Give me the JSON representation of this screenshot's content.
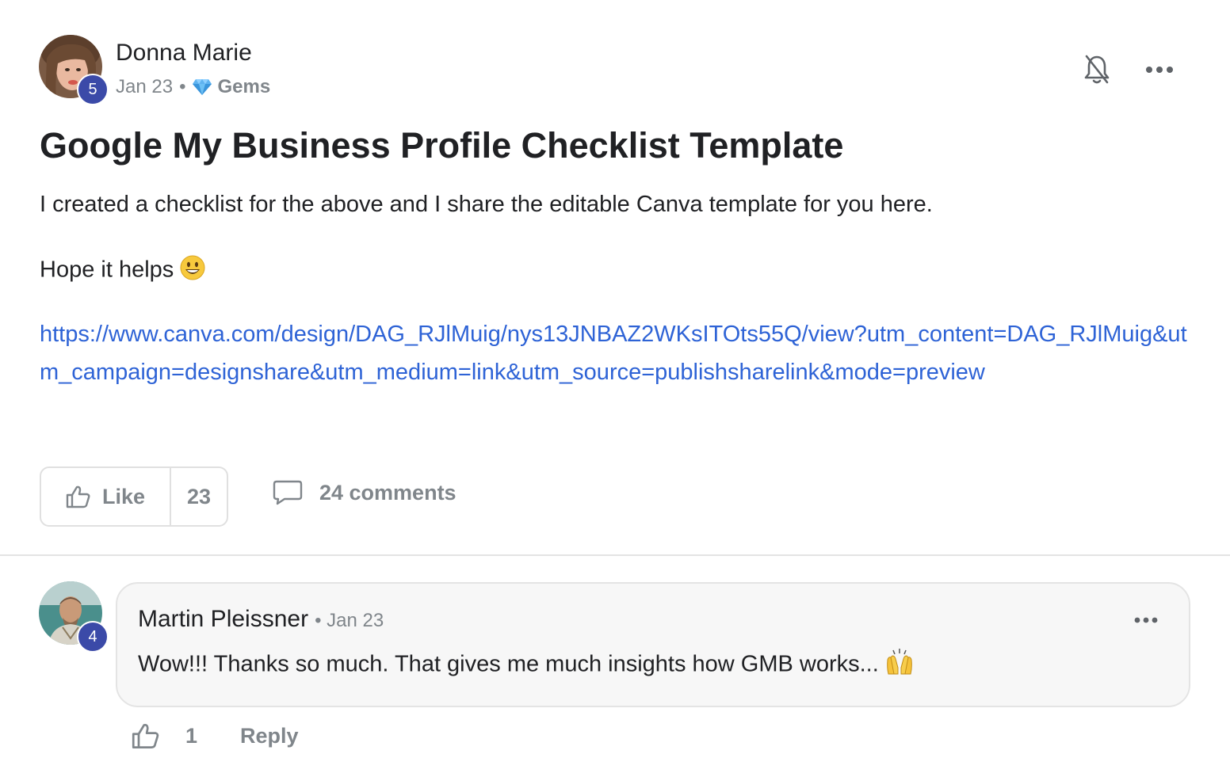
{
  "post": {
    "author": {
      "name": "Donna Marie",
      "level": "5"
    },
    "date": "Jan 23",
    "separator": "•",
    "category": "Gems",
    "title": "Google My Business Profile Checklist Template",
    "paragraphs": [
      "I created a checklist for the above and I share the editable Canva template for you here.",
      "Hope it helps"
    ],
    "link": "https://www.canva.com/design/DAG_RJlMuig/nys13JNBAZ2WKsITOts55Q/view?utm_content=DAG_RJlMuig&utm_campaign=designshare&utm_medium=link&utm_source=publishsharelink&mode=preview",
    "like_label": "Like",
    "like_count": "23",
    "comments_label": "24 comments",
    "icons": {
      "bell": "bell-off-icon",
      "more": "more-horizontal-icon",
      "gem": "gem-icon",
      "thumbs_up": "thumbs-up-icon",
      "comment": "comment-icon"
    }
  },
  "comment": {
    "author": {
      "name": "Martin Pleissner",
      "level": "4"
    },
    "date": "• Jan 23",
    "text": "Wow!!! Thanks so much. That gives me much insights how GMB works...",
    "like_count": "1",
    "reply_label": "Reply"
  },
  "colors": {
    "link": "#2e63d6",
    "level_badge": "#3b4aa8",
    "muted": "#80868b",
    "bubble_bg": "#f7f7f7"
  }
}
